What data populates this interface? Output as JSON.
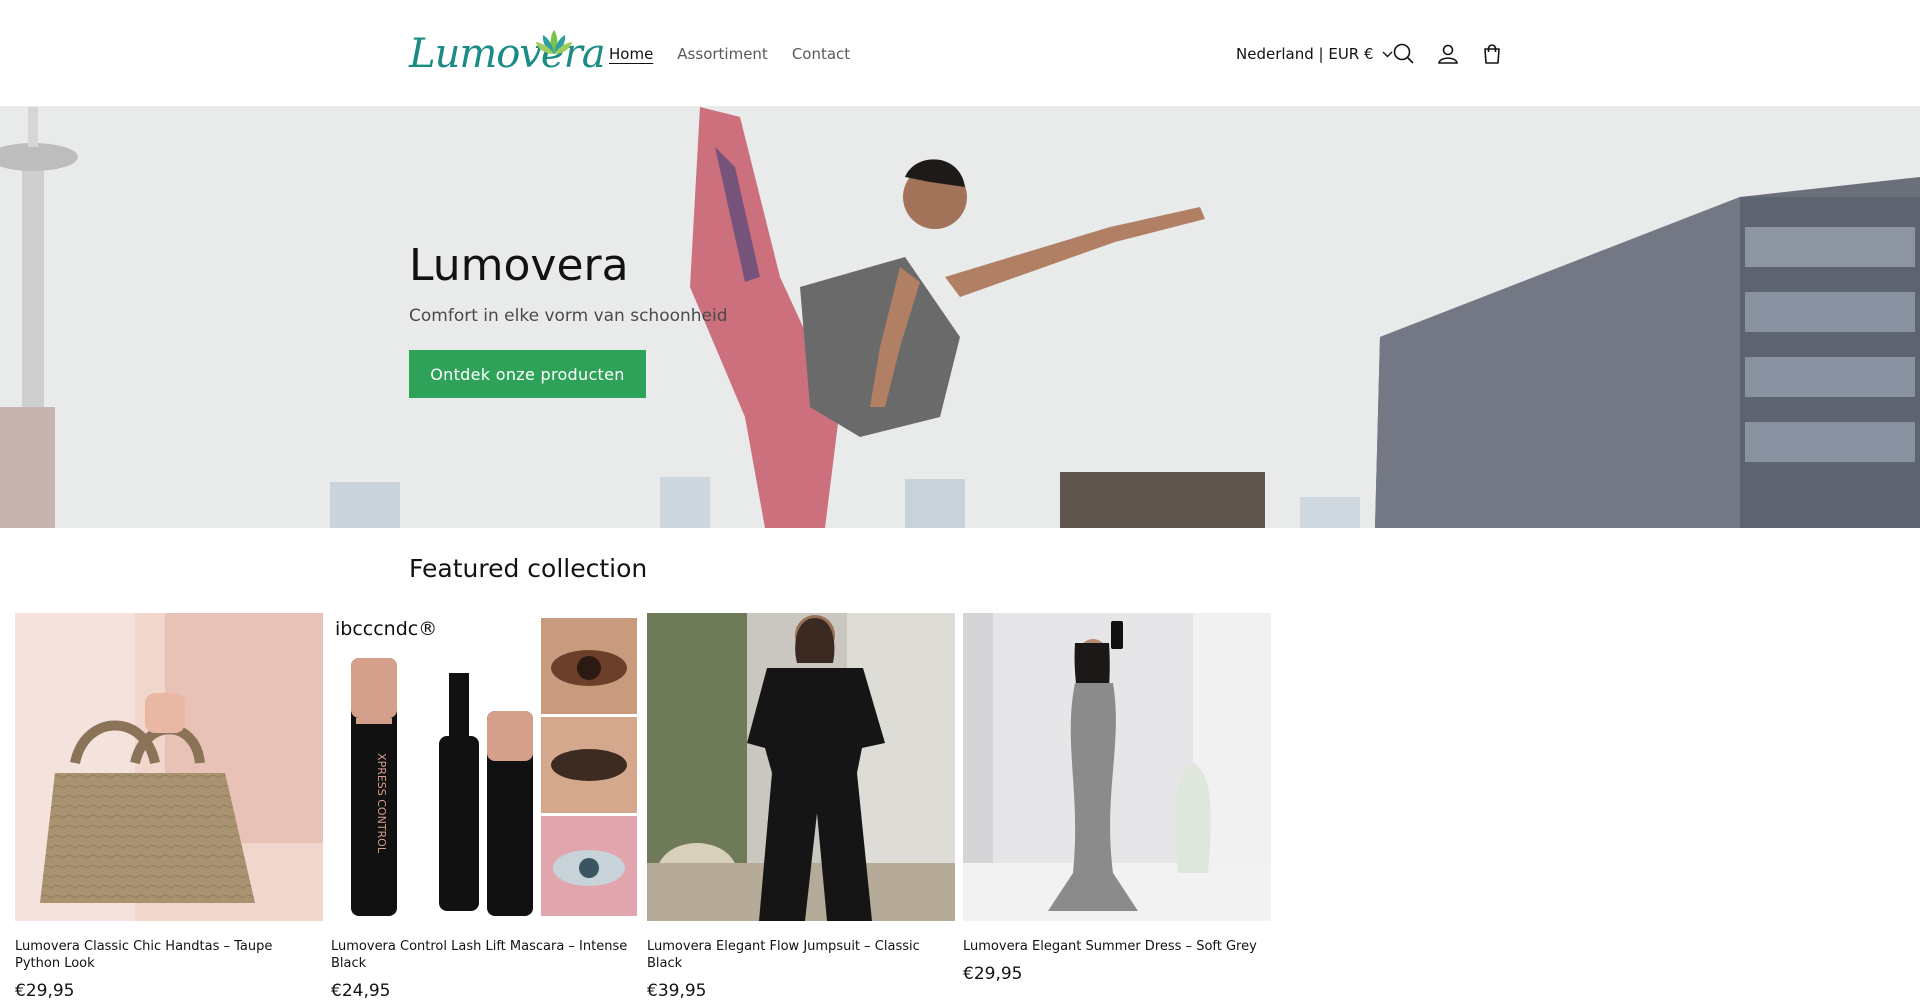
{
  "header": {
    "logo_text": "Lumovera",
    "nav": [
      {
        "label": "Home",
        "active": true
      },
      {
        "label": "Assortiment",
        "active": false
      },
      {
        "label": "Contact",
        "active": false
      }
    ],
    "region_label": "Nederland | EUR €",
    "icons": [
      "search-icon",
      "account-icon",
      "cart-icon"
    ]
  },
  "hero": {
    "title": "Lumovera",
    "subtitle": "Comfort in elke vorm van schoonheid",
    "cta_label": "Ontdek onze producten"
  },
  "featured": {
    "heading": "Featured collection",
    "products": [
      {
        "title": "Lumovera Classic Chic Handtas – Taupe Python Look",
        "price": "€29,95"
      },
      {
        "title": "Lumovera Control Lash Lift Mascara – Intense Black",
        "price": "€24,95",
        "brand_mark": "ibcccndc®",
        "product_print": "XPRESS CONTROL"
      },
      {
        "title": "Lumovera Elegant Flow Jumpsuit – Classic Black",
        "price": "€39,95"
      },
      {
        "title": "Lumovera Elegant Summer Dress – Soft Grey",
        "price": "€29,95"
      }
    ]
  },
  "colors": {
    "accent_button": "#2ea259",
    "logo_teal": "#1b8b86",
    "text": "#121212"
  }
}
